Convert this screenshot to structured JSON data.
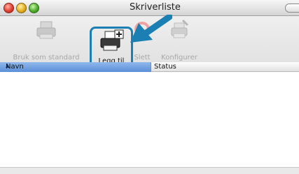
{
  "window": {
    "title": "Skriverliste"
  },
  "toolbar": {
    "default_label": "Bruk som standard",
    "add_label": "Legg til",
    "delete_label": "Slett",
    "configure_label": "Konfigurer"
  },
  "table": {
    "columns": [
      "Navn",
      "Status"
    ],
    "sort_column": "Navn",
    "rows": []
  },
  "colors": {
    "highlight_border": "#1b7fb3",
    "header_blue": "#5b8fd8",
    "arrow": "#1b7fb3"
  }
}
